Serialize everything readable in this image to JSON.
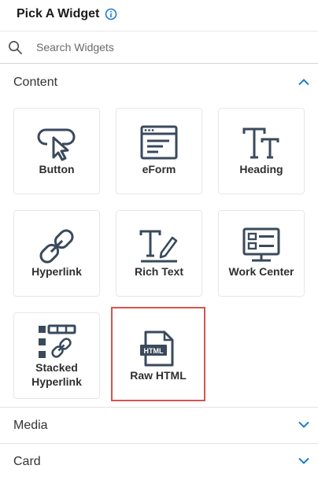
{
  "header": {
    "title": "Pick A Widget"
  },
  "search": {
    "placeholder": "Search Widgets",
    "value": ""
  },
  "sections": {
    "content": {
      "label": "Content",
      "expanded": true
    },
    "media": {
      "label": "Media",
      "expanded": false
    },
    "card": {
      "label": "Card",
      "expanded": false
    }
  },
  "widgets": [
    {
      "label": "Button",
      "icon": "button-icon"
    },
    {
      "label": "eForm",
      "icon": "eform-icon"
    },
    {
      "label": "Heading",
      "icon": "heading-icon"
    },
    {
      "label": "Hyperlink",
      "icon": "hyperlink-icon"
    },
    {
      "label": "Rich Text",
      "icon": "rich-text-icon"
    },
    {
      "label": "Work Center",
      "icon": "work-center-icon"
    },
    {
      "label_line1": "Stacked",
      "label_line2": "Hyperlink",
      "icon": "stacked-hyperlink-icon"
    },
    {
      "label": "Raw HTML",
      "icon": "raw-html-icon",
      "icon_text": "HTML",
      "selected": true
    }
  ],
  "colors": {
    "accent": "#1a7bd6",
    "icon_dark": "#3a4a5c",
    "selected_border": "#d9534f"
  }
}
